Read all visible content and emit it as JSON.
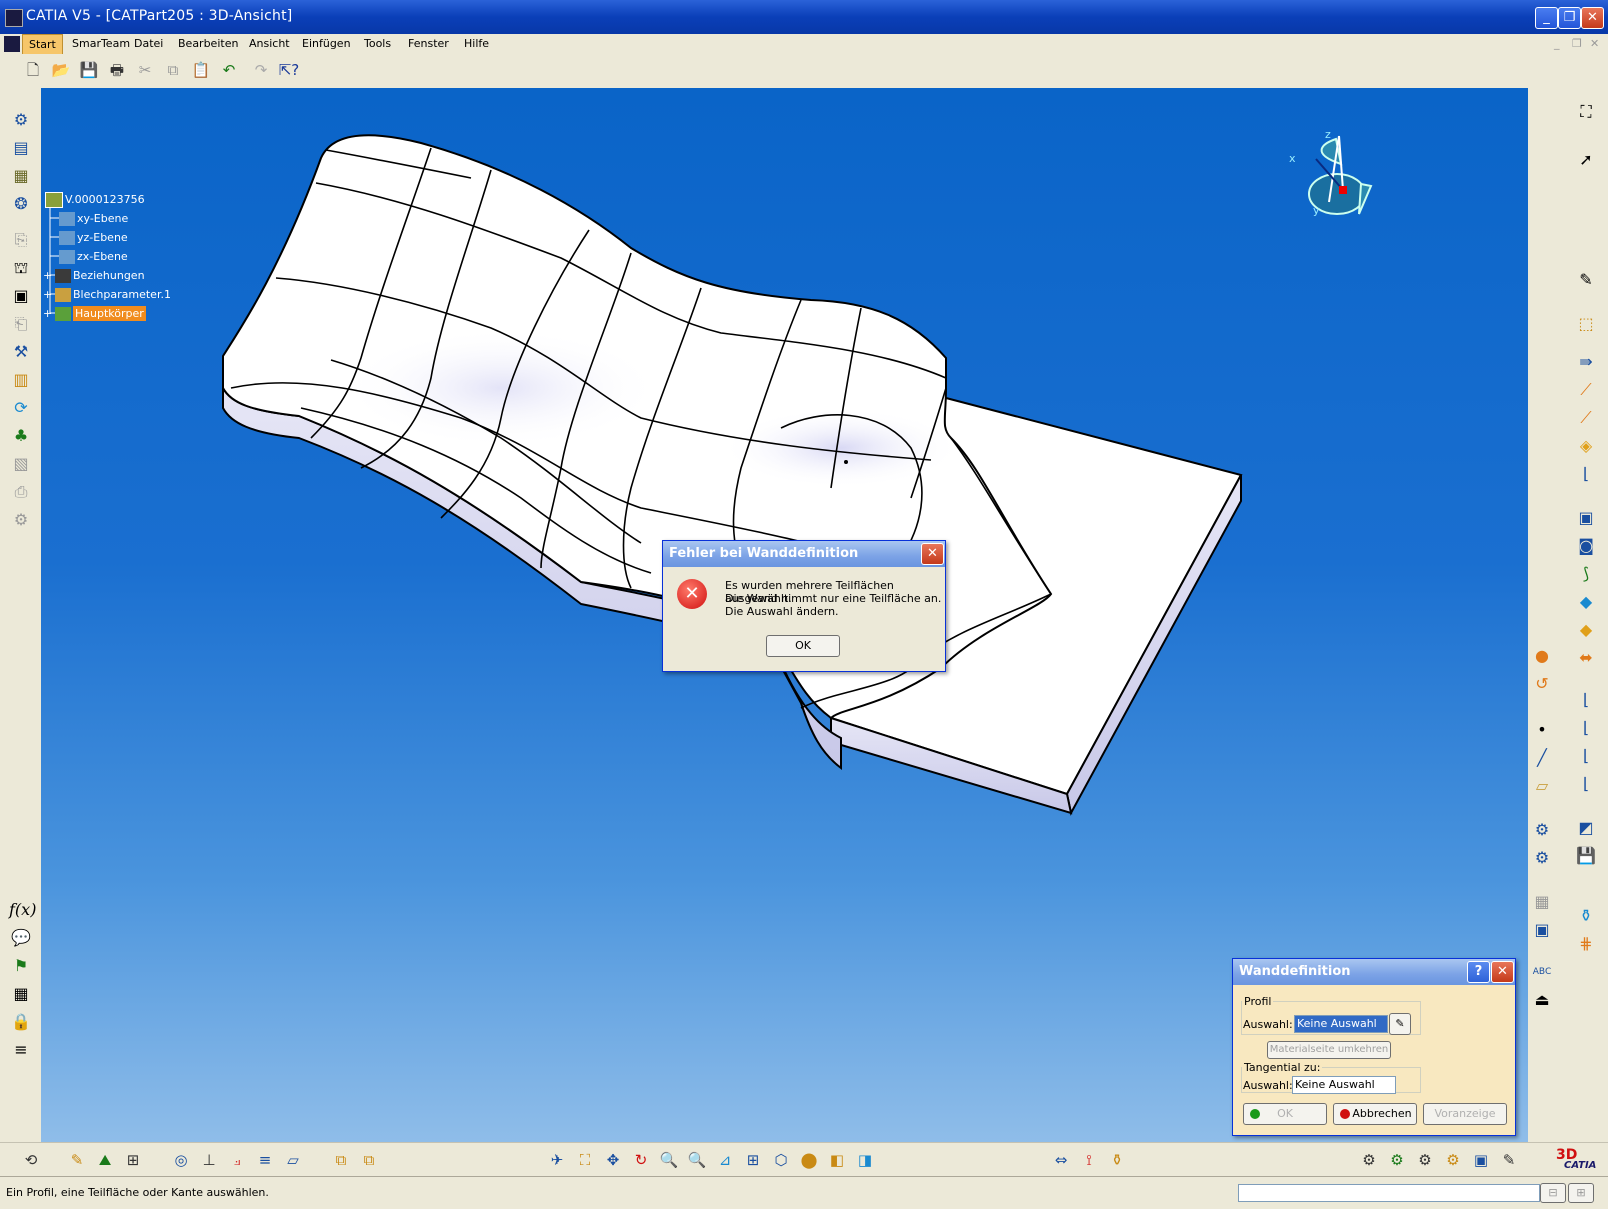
{
  "window": {
    "title": "CATIA V5 - [CATPart205 : 3D-Ansicht]"
  },
  "menu": {
    "items": [
      "Start",
      "SmarTeam",
      "Datei",
      "Bearbeiten",
      "Ansicht",
      "Einfügen",
      "Tools",
      "Fenster",
      "Hilfe"
    ]
  },
  "tree": {
    "root": "V.0000123756",
    "nodes": [
      "xy-Ebene",
      "yz-Ebene",
      "zx-Ebene",
      "Beziehungen",
      "Blechparameter.1",
      "Hauptkörper"
    ]
  },
  "error_dialog": {
    "title": "Fehler bei Wanddefinition",
    "line1": "Es wurden mehrere Teilflächen ausgewählt.",
    "line2": "Die Wand nimmt nur eine Teilfläche an.",
    "line3": "Die Auswahl ändern.",
    "ok_label": "OK"
  },
  "wall_dialog": {
    "title": "Wanddefinition",
    "profile_legend": "Profil",
    "selection_label": "Auswahl:",
    "profile_value": "Keine Auswahl",
    "material_side_label": "Materialseite umkehren",
    "tangent_legend": "Tangential zu:",
    "tangent_value": "Keine Auswahl",
    "ok_label": "OK",
    "cancel_label": "Abbrechen",
    "preview_label": "Voranzeige"
  },
  "compass": {
    "x_label": "x",
    "y_label": "y",
    "z_label": "z"
  },
  "status": {
    "message": "Ein Profil, eine Teilfläche oder Kante auswählen."
  },
  "branding": {
    "logo": "CATIA"
  }
}
